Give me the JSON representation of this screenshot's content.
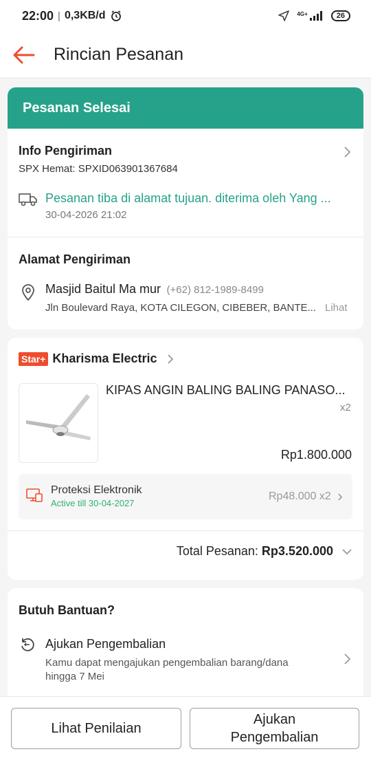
{
  "status_bar": {
    "time": "22:00",
    "separator": "|",
    "speed": "0,3KB/d",
    "network": "4G+",
    "battery": "26"
  },
  "header": {
    "title": "Rincian Pesanan"
  },
  "order_status": {
    "label": "Pesanan Selesai"
  },
  "shipping_info": {
    "title": "Info Pengiriman",
    "courier": "SPX Hemat: SPXID063901367684",
    "status_text": "Pesanan tiba di alamat tujuan. diterima oleh Yang ...",
    "timestamp": "30-04-2026 21:02"
  },
  "address": {
    "title": "Alamat Pengiriman",
    "name": "Masjid Baitul Ma mur",
    "phone": "(+62) 812-1989-8499",
    "line": "Jln Boulevard Raya, KOTA CILEGON, CIBEBER, BANTE...",
    "more_label": "Lihat"
  },
  "shop": {
    "badge": "Star+",
    "name": "Kharisma Electric",
    "product": {
      "name": "KIPAS ANGIN BALING BALING PANASO...",
      "qty": "x2",
      "price": "Rp1.800.000"
    },
    "protection": {
      "title": "Proteksi Elektronik",
      "validity": "Active till 30-04-2027",
      "price": "Rp48.000 x2"
    },
    "total_label": "Total Pesanan:",
    "total_value": "Rp3.520.000"
  },
  "help": {
    "title": "Butuh Bantuan?",
    "return_title": "Ajukan Pengembalian",
    "return_desc_1": "Kamu dapat mengajukan pengembalian barang/dana",
    "return_desc_2": "hingga 7 Mei"
  },
  "actions": {
    "review_label": "Lihat Penilaian",
    "return_label_1": "Ajukan",
    "return_label_2": "Pengembalian"
  },
  "colors": {
    "accent": "#ee4d2d",
    "success": "#26a28a"
  }
}
